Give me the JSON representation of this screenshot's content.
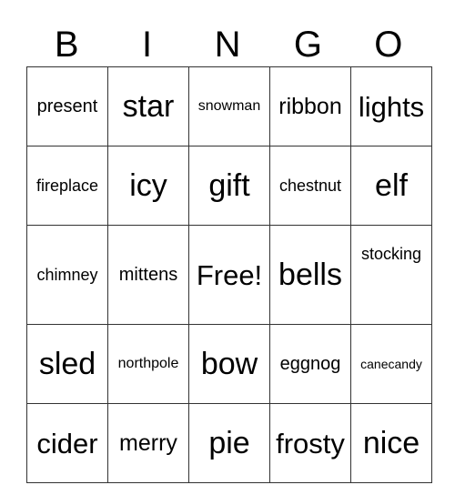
{
  "header": [
    "B",
    "I",
    "N",
    "G",
    "O"
  ],
  "rows": [
    [
      "present",
      "star",
      "snowman",
      "ribbon",
      "lights"
    ],
    [
      "fireplace",
      "icy",
      "gift",
      "chestnut",
      "elf"
    ],
    [
      "chimney",
      "mittens",
      "Free!",
      "bells",
      "stocking"
    ],
    [
      "sled",
      "northpole",
      "bow",
      "eggnog",
      "canecandy"
    ],
    [
      "cider",
      "merry",
      "pie",
      "frosty",
      "nice"
    ]
  ]
}
